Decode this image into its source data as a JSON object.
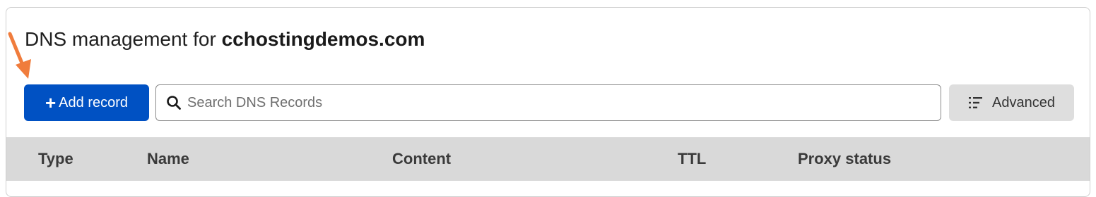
{
  "header": {
    "title_prefix": "DNS management for ",
    "domain": "cchostingdemos.com"
  },
  "toolbar": {
    "add_label": "Add record",
    "add_icon": "plus-icon",
    "search_placeholder": "Search DNS Records",
    "search_icon": "search-icon",
    "advanced_label": "Advanced",
    "advanced_icon": "list-filter-icon"
  },
  "table": {
    "columns": [
      "Type",
      "Name",
      "Content",
      "TTL",
      "Proxy status"
    ]
  },
  "colors": {
    "primary": "#0051c3",
    "annotation_arrow": "#f07c3c",
    "header_bg": "#d9d9d9"
  }
}
